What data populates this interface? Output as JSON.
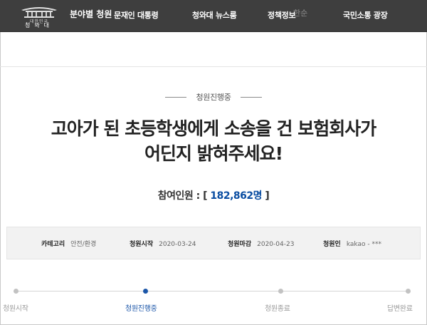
{
  "nav": {
    "logo_sub": "대한민국",
    "logo_name": "청와대",
    "section": "분야별 청원",
    "items": [
      "문재인 대통령",
      "청와대 뉴스룸",
      "정책정보",
      "국민소통 광장"
    ],
    "ghost": "한순"
  },
  "petition": {
    "status": "청원진행중",
    "title_line1": "고아가 된 초등학생에게 소송을 건 보험회사가",
    "title_line2": "어딘지 밝혀주세요!",
    "count_label": "참여인원 : [",
    "count_value": "182,862명",
    "count_close": "]"
  },
  "info": {
    "category_label": "카테고리",
    "category_value": "안전/환경",
    "start_label": "청원시작",
    "start_value": "2020-03-24",
    "end_label": "청원마감",
    "end_value": "2020-04-23",
    "author_label": "청원인",
    "author_value": "kakao - ***"
  },
  "progress": {
    "steps": [
      "청원시작",
      "청원진행중",
      "청원종료",
      "답변완료"
    ],
    "active_index": 1,
    "active_color": "#1b56a8"
  }
}
